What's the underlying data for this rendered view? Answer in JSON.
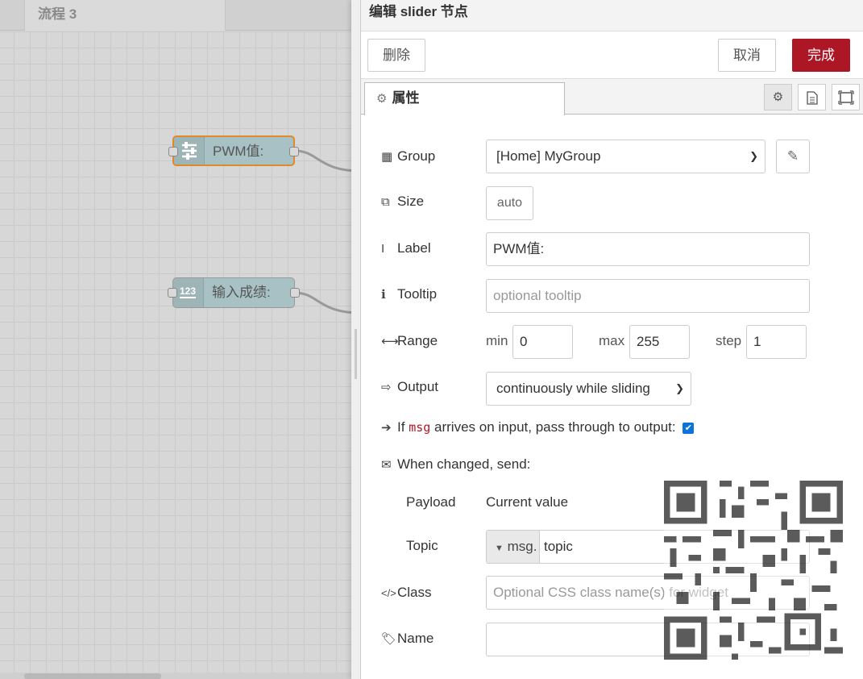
{
  "workspace": {
    "flow_tab": "流程 3",
    "nodes": [
      {
        "label": "PWM值:",
        "icon": "slider-icon"
      },
      {
        "label": "输入成绩:",
        "icon": "numeric-icon",
        "badge": "123"
      }
    ]
  },
  "editor": {
    "title": "编辑 slider 节点",
    "buttons": {
      "delete": "删除",
      "cancel": "取消",
      "done": "完成"
    },
    "tab_properties": "属性",
    "colors": {
      "done": "#ad1625",
      "accent": "#0b73d9"
    },
    "group": {
      "label": "Group",
      "value": "[Home] MyGroup"
    },
    "size": {
      "label": "Size",
      "value": "auto"
    },
    "label_field": {
      "label": "Label",
      "value": "PWM值:"
    },
    "tooltip": {
      "label": "Tooltip",
      "placeholder": "optional tooltip"
    },
    "range": {
      "label": "Range",
      "min_label": "min",
      "min": "0",
      "max_label": "max",
      "max": "255",
      "step_label": "step",
      "step": "1"
    },
    "output": {
      "label": "Output",
      "value": "continuously while sliding"
    },
    "passthrough": {
      "prefix": "If",
      "code": "msg",
      "suffix": "arrives on input, pass through to output:",
      "checked": true
    },
    "when_changed": {
      "label": "When changed, send:"
    },
    "payload": {
      "label": "Payload",
      "value": "Current value"
    },
    "topic": {
      "label": "Topic",
      "type": "msg.",
      "value": "topic"
    },
    "class_field": {
      "label": "Class",
      "placeholder": "Optional CSS class name(s) for widget"
    },
    "name": {
      "label": "Name",
      "value": ""
    }
  }
}
